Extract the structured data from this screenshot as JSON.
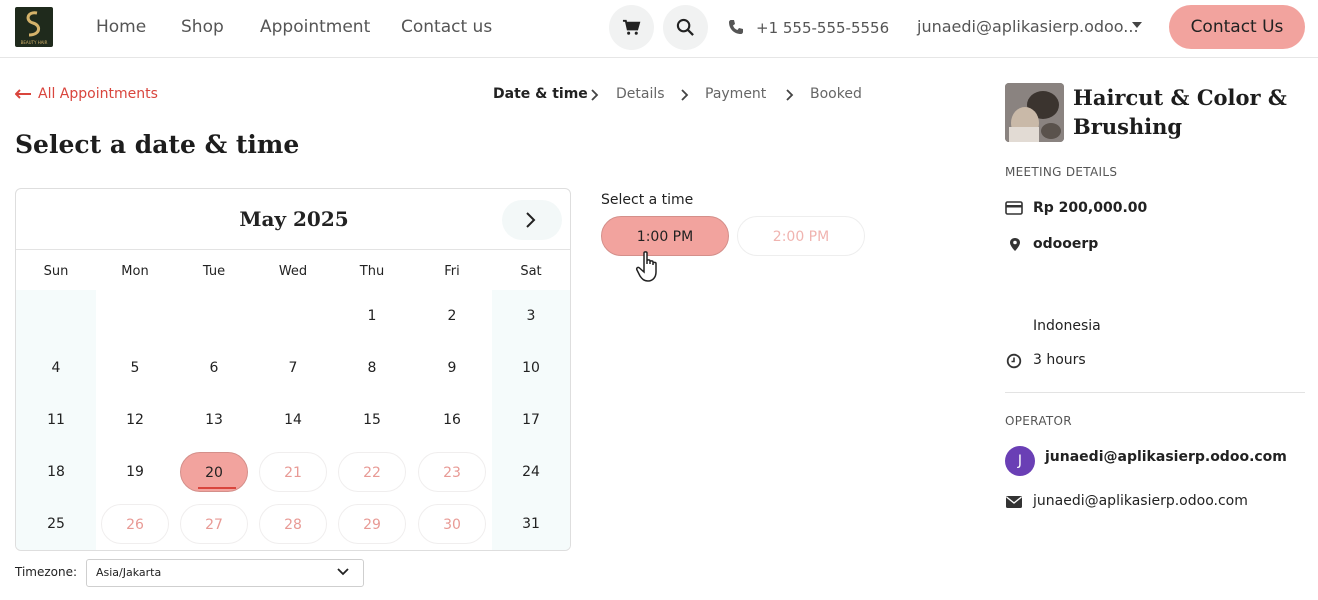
{
  "brand": {
    "logo_text": "BEAUTY HAIR"
  },
  "nav": {
    "links": [
      "Home",
      "Shop",
      "Appointment",
      "Contact us"
    ],
    "phone": "+1 555-555-5556",
    "user": "junaedi@aplikasierp.odoo...",
    "cta": "Contact Us"
  },
  "breadcrumb": {
    "back": "All Appointments",
    "steps": [
      "Date & time",
      "Details",
      "Payment",
      "Booked"
    ]
  },
  "page": {
    "title": "Select a date & time"
  },
  "calendar": {
    "month": "May 2025",
    "weekdays": [
      "Sun",
      "Mon",
      "Tue",
      "Wed",
      "Thu",
      "Fri",
      "Sat"
    ],
    "weeks": [
      [
        "",
        "",
        "",
        "",
        "1",
        "2",
        "3"
      ],
      [
        "4",
        "5",
        "6",
        "7",
        "8",
        "9",
        "10"
      ],
      [
        "11",
        "12",
        "13",
        "14",
        "15",
        "16",
        "17"
      ],
      [
        "18",
        "19",
        "20",
        "21",
        "22",
        "23",
        "24"
      ],
      [
        "25",
        "26",
        "27",
        "28",
        "29",
        "30",
        "31"
      ]
    ],
    "available_days": [
      "21",
      "22",
      "23",
      "26",
      "27",
      "28",
      "29",
      "30"
    ],
    "selected_day": "20"
  },
  "timezone": {
    "label": "Timezone:",
    "value": "Asia/Jakarta"
  },
  "time": {
    "label": "Select a time",
    "slots": [
      "1:00 PM",
      "2:00 PM"
    ],
    "selected": "1:00 PM"
  },
  "service": {
    "title": "Haircut & Color & Brushing",
    "meeting_label": "MEETING DETAILS",
    "price": "Rp 200,000.00",
    "location": "odooerp",
    "country": "Indonesia",
    "duration": "3 hours",
    "operator_label": "OPERATOR",
    "operator_initial": "J",
    "operator_name": "junaedi@aplikasierp.odoo.com",
    "operator_email": "junaedi@aplikasierp.odoo.com"
  },
  "colors": {
    "accent": "#f2a39e",
    "link": "#d9453d",
    "avatar": "#6a3fb5"
  }
}
